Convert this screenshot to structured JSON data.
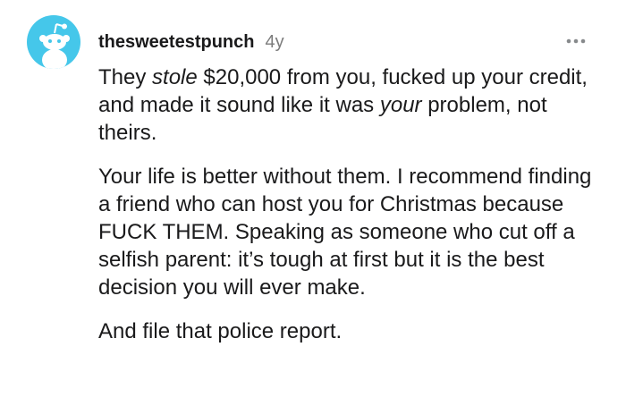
{
  "comment": {
    "username": "thesweetestpunch",
    "age": "4y",
    "more_icon": "more-horizontal-icon",
    "avatar_icon": "reddit-snoo-icon",
    "avatar_color": "#45c7ea",
    "paragraphs": {
      "p1": {
        "t1": "They ",
        "em1": "stole",
        "t2": " $20,000 from you, fucked up your credit, and made it sound like it was ",
        "em2": "your",
        "t3": " problem, not theirs."
      },
      "p2": "Your life is better without them. I recommend finding a friend who can host you for Christmas because FUCK THEM. Speaking as someone who cut off a selfish parent: it’s tough at first but it is the best decision you will ever make.",
      "p3": "And file that police report."
    }
  }
}
